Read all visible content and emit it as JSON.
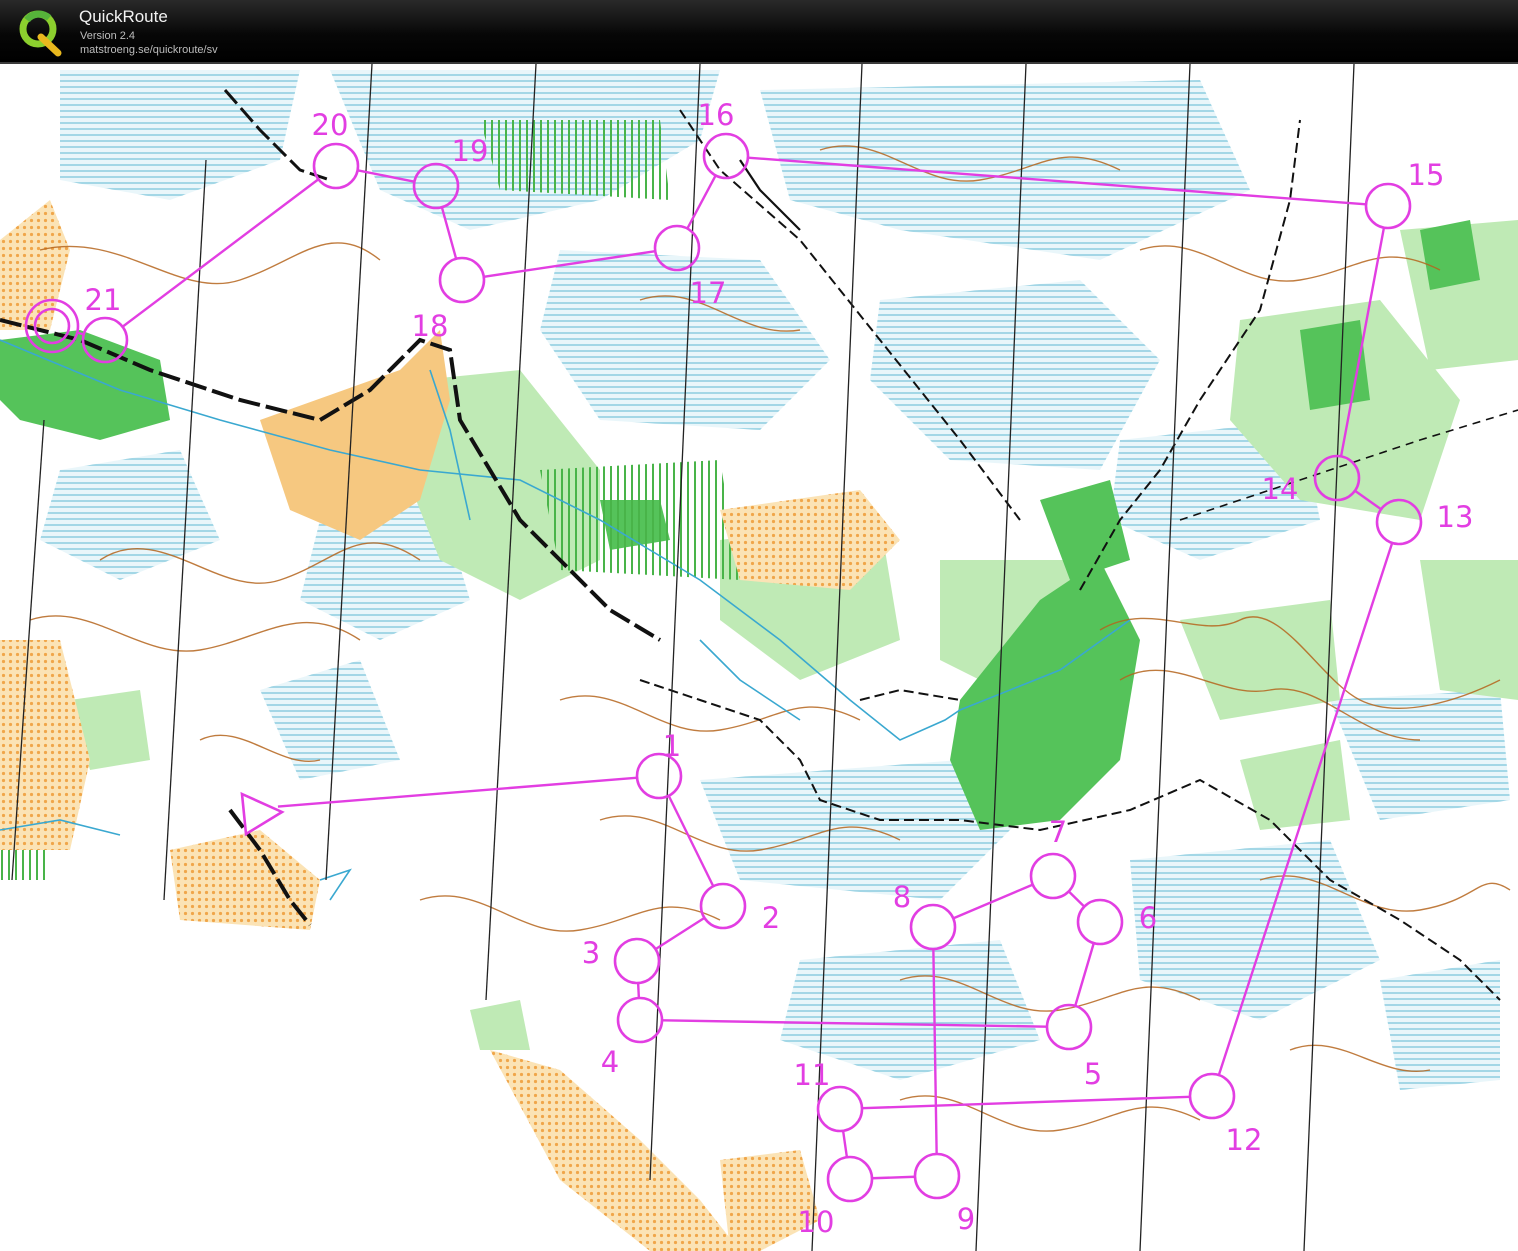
{
  "app": {
    "title": "QuickRoute",
    "version": "Version 2.4",
    "url": "matstroeng.se/quickroute/sv"
  },
  "icons": {
    "logo": "quickroute-q-logo"
  },
  "colors": {
    "course": "#e23ee2",
    "contour": "#b5651d",
    "water": "#9ed6e4",
    "vegetation_light": "#bfeab5",
    "vegetation_dark": "#55c35a",
    "open_land": "#f6c06e",
    "path": "#222222",
    "titlebar": "#0a0a0a"
  },
  "course": {
    "start_label": "start",
    "finish_label": "finish",
    "controls": [
      {
        "n": "1"
      },
      {
        "n": "2"
      },
      {
        "n": "3"
      },
      {
        "n": "4"
      },
      {
        "n": "5"
      },
      {
        "n": "6"
      },
      {
        "n": "7"
      },
      {
        "n": "8"
      },
      {
        "n": "9"
      },
      {
        "n": "10"
      },
      {
        "n": "11"
      },
      {
        "n": "12"
      },
      {
        "n": "13"
      },
      {
        "n": "14"
      },
      {
        "n": "15"
      },
      {
        "n": "16"
      },
      {
        "n": "17"
      },
      {
        "n": "18"
      },
      {
        "n": "19"
      },
      {
        "n": "20"
      },
      {
        "n": "21"
      }
    ]
  }
}
